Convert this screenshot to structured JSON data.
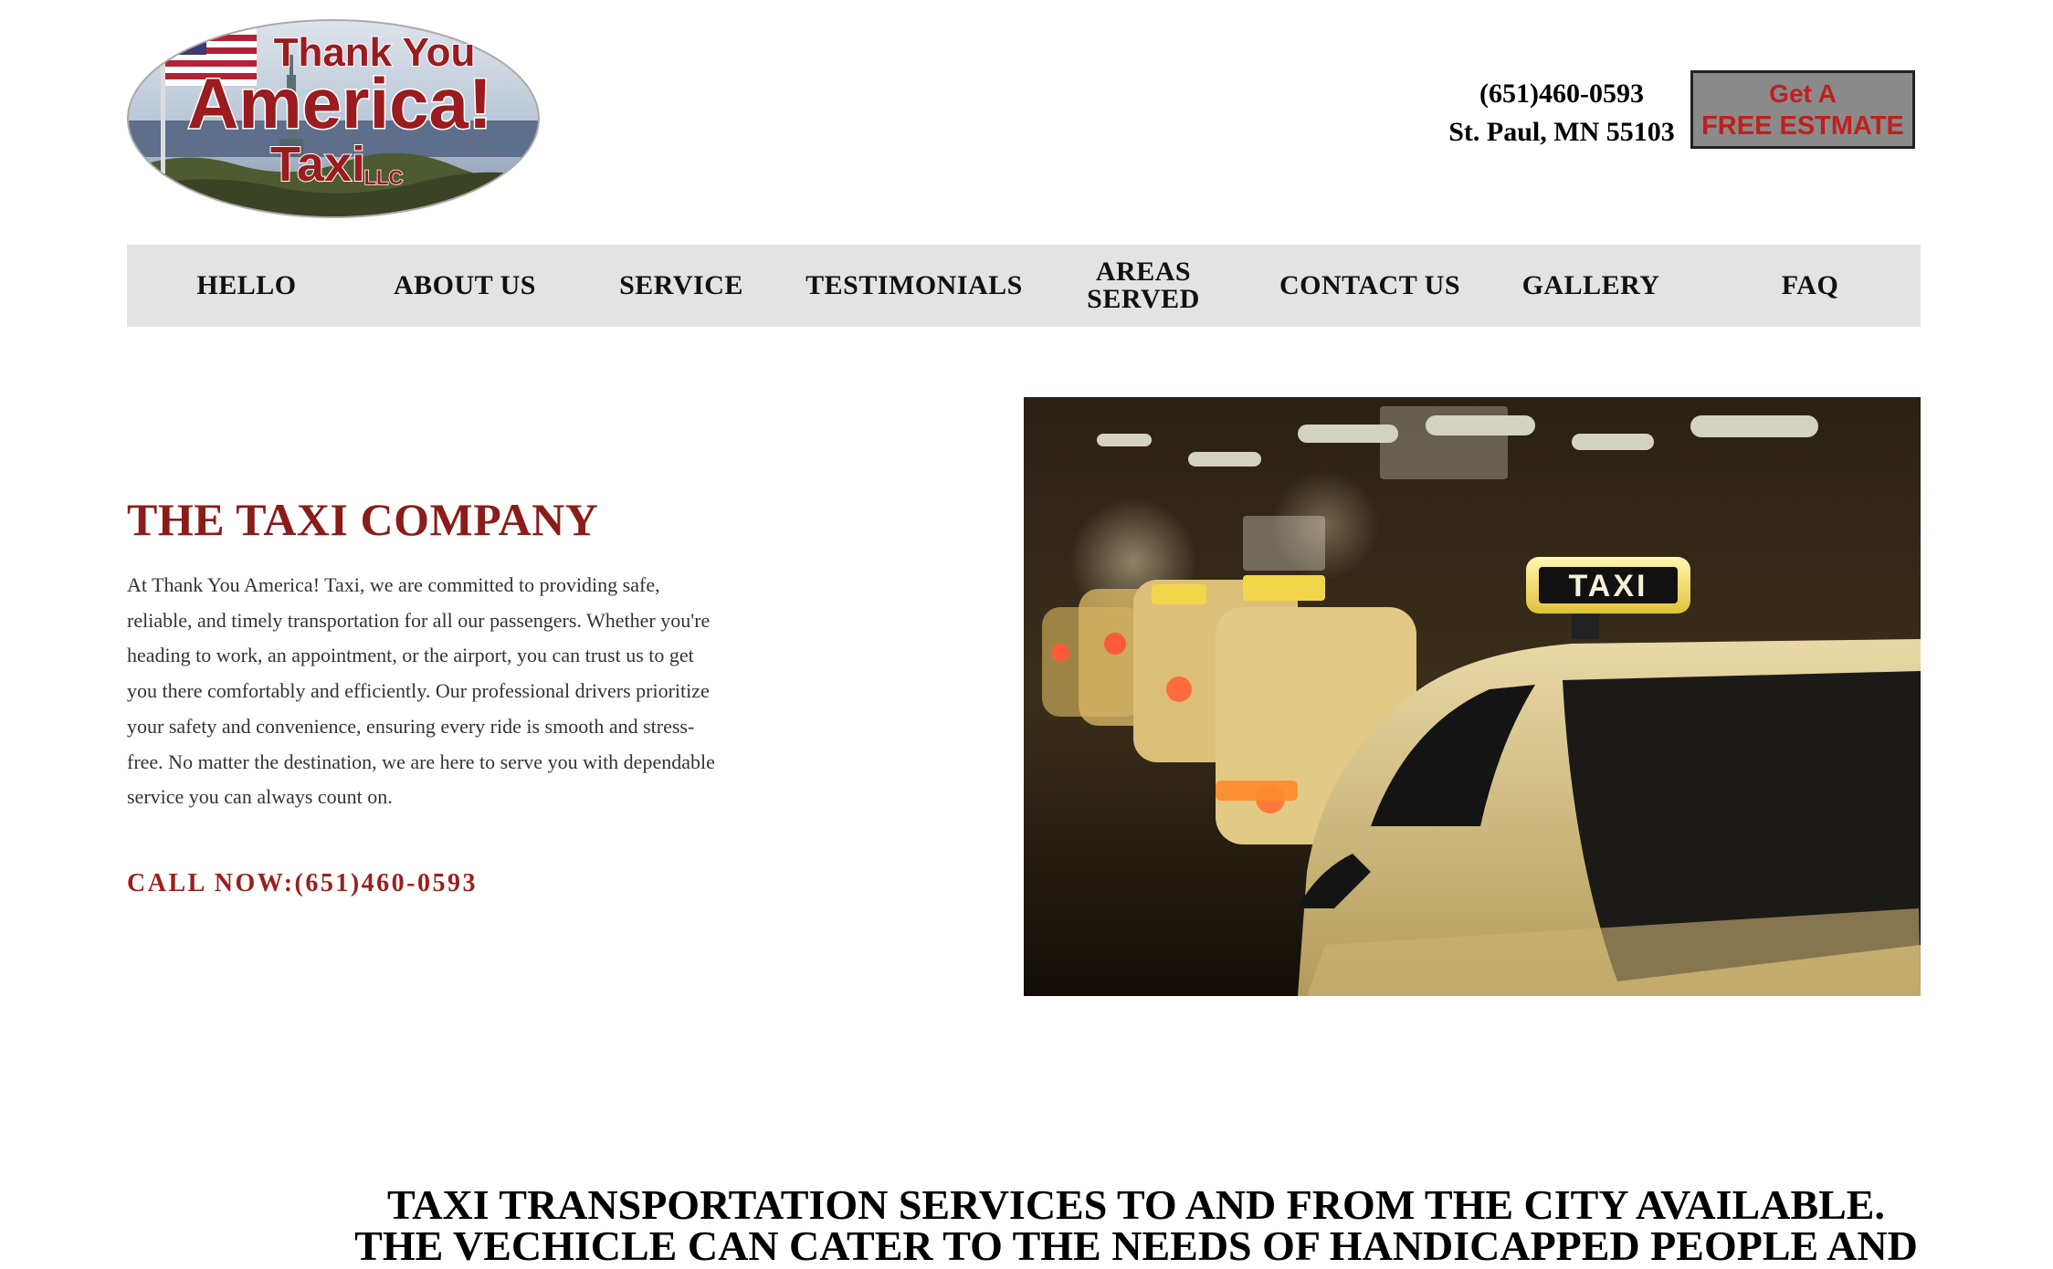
{
  "logo": {
    "line1": "Thank You",
    "line2": "America!",
    "line3": "Taxi",
    "suffix": "LLC"
  },
  "header": {
    "phone": "(651)460-0593",
    "address": "St. Paul, MN 55103",
    "estimate_line1": "Get A",
    "estimate_line2": "FREE ESTMATE"
  },
  "nav": {
    "items": [
      {
        "label": "HELLO"
      },
      {
        "label": "ABOUT US"
      },
      {
        "label": "SERVICE"
      },
      {
        "label": "TESTIMONIALS"
      },
      {
        "label": "AREAS SERVED"
      },
      {
        "label": "CONTACT US"
      },
      {
        "label": "GALLERY"
      },
      {
        "label": "FAQ"
      }
    ]
  },
  "hero": {
    "title": "THE TAXI COMPANY",
    "body": "At Thank You America! Taxi, we are committed to providing safe, reliable, and timely transportation for all our passengers. Whether you're heading to work, an appointment, or the airport, you can trust us to get you there comfortably and efficiently. Our professional drivers prioritize your safety and convenience, ensuring every ride is smooth and stress-free. No matter the destination, we are here to serve you with dependable service you can always count on.",
    "call_now": "CALL NOW:(651)460-0593",
    "photo_sign": "TAXI"
  },
  "banner": {
    "line1": "TAXI TRANSPORTATION SERVICES TO AND FROM THE CITY AVAILABLE.",
    "line2": "THE VECHICLE CAN CATER TO THE NEEDS OF HANDICAPPED PEOPLE AND"
  },
  "colors": {
    "accent_red": "#8b1c1a",
    "nav_bg": "#e3e3e3",
    "button_bg": "#8a8a8a"
  }
}
